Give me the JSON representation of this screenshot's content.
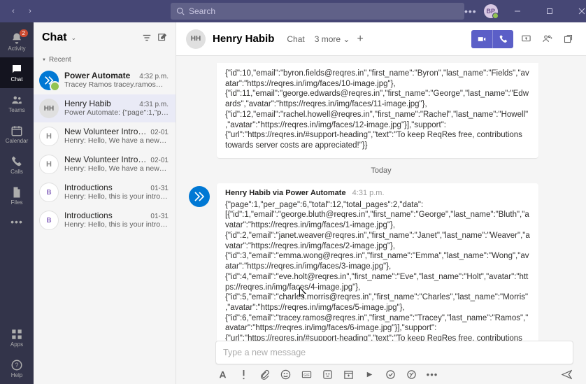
{
  "search": {
    "placeholder": "Search"
  },
  "user_badge": "BP",
  "rail": {
    "items": [
      {
        "key": "activity",
        "label": "Activity",
        "badge": "2"
      },
      {
        "key": "chat",
        "label": "Chat"
      },
      {
        "key": "teams",
        "label": "Teams"
      },
      {
        "key": "calendar",
        "label": "Calendar"
      },
      {
        "key": "calls",
        "label": "Calls"
      },
      {
        "key": "files",
        "label": "Files"
      }
    ],
    "apps_label": "Apps",
    "help_label": "Help"
  },
  "chatlist": {
    "title": "Chat",
    "recent_label": "Recent",
    "items": [
      {
        "avatar": "flow",
        "initials": "",
        "name": "Power Automate",
        "time": "4:32 p.m.",
        "preview": "Tracey Ramos tracey.ramos@…",
        "unread": true
      },
      {
        "avatar": "hh",
        "initials": "HH",
        "name": "Henry Habib",
        "time": "4:31 p.m.",
        "preview": "Power Automate: {\"page\":1,\"pe…",
        "selected": true
      },
      {
        "avatar": "h",
        "initials": "H",
        "name": "New Volunteer Introduct…",
        "time": "02-01",
        "preview": "Henry: Hello, We have a new vol…"
      },
      {
        "avatar": "h",
        "initials": "H",
        "name": "New Volunteer Introduct…",
        "time": "02-01",
        "preview": "Henry: Hello, We have a new vol…"
      },
      {
        "avatar": "b",
        "initials": "B",
        "name": "Introductions",
        "time": "01-31",
        "preview": "Henry: Hello, this is your introdu…"
      },
      {
        "avatar": "b",
        "initials": "B",
        "name": "Introductions",
        "time": "01-31",
        "preview": "Henry: Hello, this is your introdu…"
      }
    ]
  },
  "header": {
    "initials": "HH",
    "name": "Henry Habib",
    "tabs": {
      "chat": "Chat",
      "more": "3 more",
      "more_chev": "⌄"
    }
  },
  "conversation": {
    "prev_fragment": "{\"id\":10,\"email\":\"byron.fields@reqres.in\",\"first_name\":\"Byron\",\"last_name\":\"Fields\",\"avatar\":\"https://reqres.in/img/faces/10-image.jpg\"},{\"id\":11,\"email\":\"george.edwards@reqres.in\",\"first_name\":\"George\",\"last_name\":\"Edwards\",\"avatar\":\"https://reqres.in/img/faces/11-image.jpg\"},{\"id\":12,\"email\":\"rachel.howell@reqres.in\",\"first_name\":\"Rachel\",\"last_name\":\"Howell\",\"avatar\":\"https://reqres.in/img/faces/12-image.jpg\"}],\"support\":{\"url\":\"https://reqres.in/#support-heading\",\"text\":\"To keep ReqRes free, contributions towards server costs are appreciated!\"}}",
    "day_separator": "Today",
    "message": {
      "sender": "Henry Habib via Power Automate",
      "time": "4:31 p.m.",
      "body": "{\"page\":1,\"per_page\":6,\"total\":12,\"total_pages\":2,\"data\":[{\"id\":1,\"email\":\"george.bluth@reqres.in\",\"first_name\":\"George\",\"last_name\":\"Bluth\",\"avatar\":\"https://reqres.in/img/faces/1-image.jpg\"},{\"id\":2,\"email\":\"janet.weaver@reqres.in\",\"first_name\":\"Janet\",\"last_name\":\"Weaver\",\"avatar\":\"https://reqres.in/img/faces/2-image.jpg\"},{\"id\":3,\"email\":\"emma.wong@reqres.in\",\"first_name\":\"Emma\",\"last_name\":\"Wong\",\"avatar\":\"https://reqres.in/img/faces/3-image.jpg\"},{\"id\":4,\"email\":\"eve.holt@reqres.in\",\"first_name\":\"Eve\",\"last_name\":\"Holt\",\"avatar\":\"https://reqres.in/img/faces/4-image.jpg\"},{\"id\":5,\"email\":\"charles.morris@reqres.in\",\"first_name\":\"Charles\",\"last_name\":\"Morris\",\"avatar\":\"https://reqres.in/img/faces/5-image.jpg\"},{\"id\":6,\"email\":\"tracey.ramos@reqres.in\",\"first_name\":\"Tracey\",\"last_name\":\"Ramos\",\"avatar\":\"https://reqres.in/img/faces/6-image.jpg\"}],\"support\":{\"url\":\"https://reqres.in/#support-heading\",\"text\":\"To keep ReqRes free, contributions towards server costs are appreciated!\"}}"
    }
  },
  "composer": {
    "placeholder": "Type a new message"
  }
}
